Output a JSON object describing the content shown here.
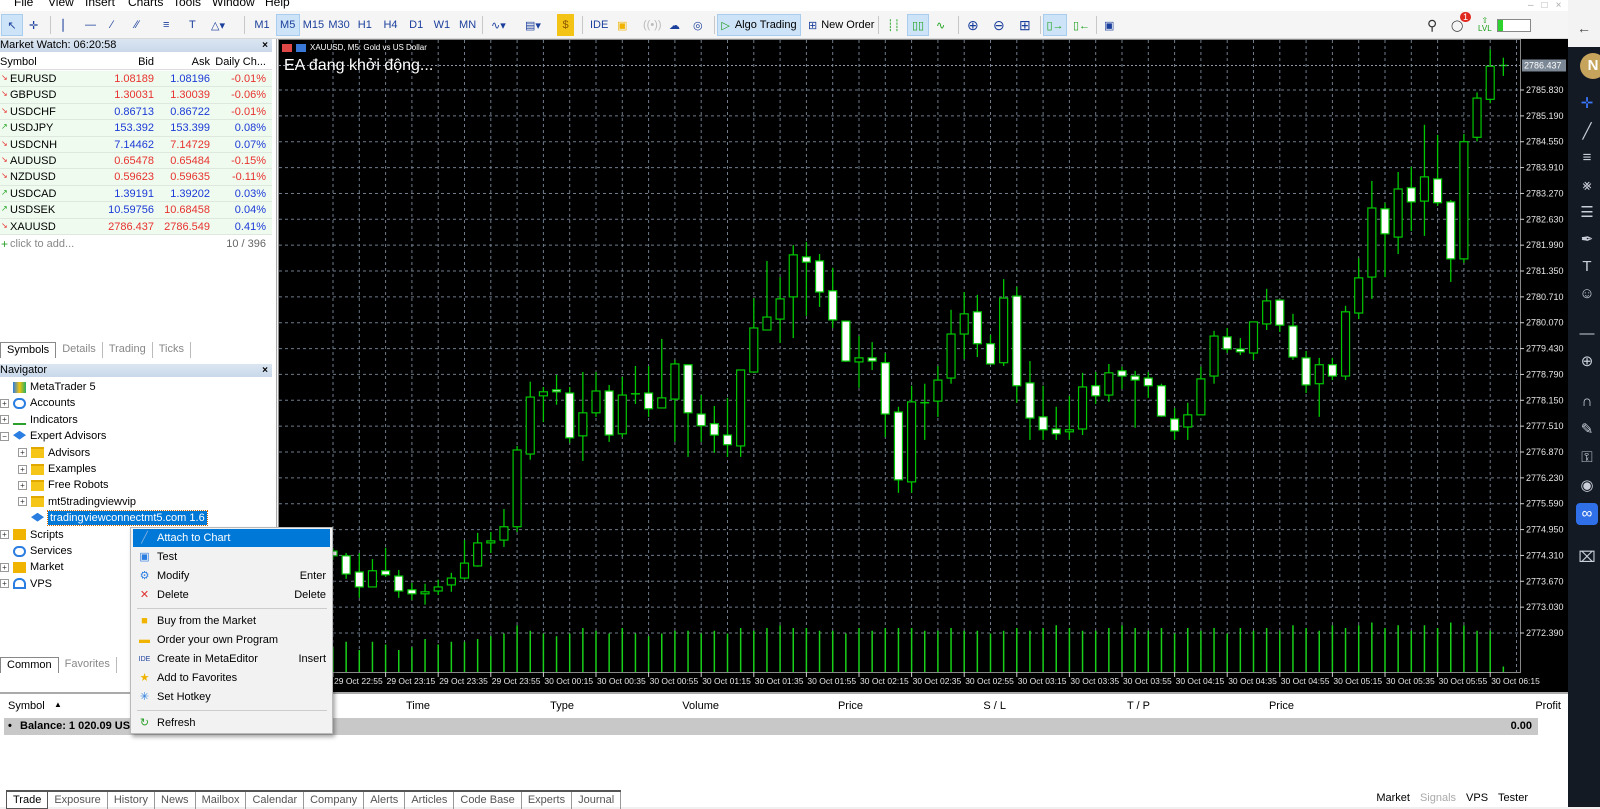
{
  "menu": [
    "File",
    "View",
    "Insert",
    "Charts",
    "Tools",
    "Window",
    "Help"
  ],
  "toolbar": {
    "timeframes": [
      "M1",
      "M5",
      "M15",
      "M30",
      "H1",
      "H4",
      "D1",
      "W1",
      "MN"
    ],
    "active_timeframe": "M5",
    "ide_label": "IDE",
    "algo_trading_label": "Algo Trading",
    "new_order_label": "New Order",
    "notification_count": "1",
    "lvl_label": "LVL",
    "user_initial": "N"
  },
  "market_watch": {
    "title": "Market Watch: 06:20:58",
    "columns": [
      "Symbol",
      "Bid",
      "Ask",
      "Daily Ch..."
    ],
    "rows": [
      {
        "symbol": "EURUSD",
        "bid": "1.08189",
        "ask": "1.08196",
        "change": "-0.01%",
        "dir": "down",
        "bid_c": "r",
        "ask_c": "b",
        "chg_c": "r"
      },
      {
        "symbol": "GBPUSD",
        "bid": "1.30031",
        "ask": "1.30039",
        "change": "-0.06%",
        "dir": "down",
        "bid_c": "r",
        "ask_c": "r",
        "chg_c": "r"
      },
      {
        "symbol": "USDCHF",
        "bid": "0.86713",
        "ask": "0.86722",
        "change": "-0.01%",
        "dir": "down",
        "bid_c": "b",
        "ask_c": "b",
        "chg_c": "r"
      },
      {
        "symbol": "USDJPY",
        "bid": "153.392",
        "ask": "153.399",
        "change": "0.08%",
        "dir": "up",
        "bid_c": "b",
        "ask_c": "b",
        "chg_c": "b"
      },
      {
        "symbol": "USDCNH",
        "bid": "7.14462",
        "ask": "7.14729",
        "change": "0.07%",
        "dir": "down",
        "bid_c": "b",
        "ask_c": "r",
        "chg_c": "b"
      },
      {
        "symbol": "AUDUSD",
        "bid": "0.65478",
        "ask": "0.65484",
        "change": "-0.15%",
        "dir": "down",
        "bid_c": "r",
        "ask_c": "r",
        "chg_c": "r"
      },
      {
        "symbol": "NZDUSD",
        "bid": "0.59623",
        "ask": "0.59635",
        "change": "-0.11%",
        "dir": "down",
        "bid_c": "r",
        "ask_c": "r",
        "chg_c": "r"
      },
      {
        "symbol": "USDCAD",
        "bid": "1.39191",
        "ask": "1.39202",
        "change": "0.03%",
        "dir": "up",
        "bid_c": "b",
        "ask_c": "b",
        "chg_c": "b"
      },
      {
        "symbol": "USDSEK",
        "bid": "10.59756",
        "ask": "10.68458",
        "change": "0.04%",
        "dir": "up",
        "bid_c": "b",
        "ask_c": "r",
        "chg_c": "b"
      },
      {
        "symbol": "XAUUSD",
        "bid": "2786.437",
        "ask": "2786.549",
        "change": "0.41%",
        "dir": "down",
        "bid_c": "r",
        "ask_c": "r",
        "chg_c": "b"
      }
    ],
    "add_label": "click to add...",
    "count": "10 / 396",
    "tabs": [
      "Symbols",
      "Details",
      "Trading",
      "Ticks"
    ]
  },
  "navigator": {
    "title": "Navigator",
    "items": [
      {
        "label": "MetaTrader 5",
        "level": 0,
        "icon": "metatrader-icon",
        "exp": ""
      },
      {
        "label": "Accounts",
        "level": 1,
        "icon": "accounts-icon",
        "exp": "+"
      },
      {
        "label": "Indicators",
        "level": 1,
        "icon": "indicators-icon",
        "exp": "+"
      },
      {
        "label": "Expert Advisors",
        "level": 1,
        "icon": "expert-advisors-icon",
        "exp": "-"
      },
      {
        "label": "Advisors",
        "level": 2,
        "icon": "folder-icon",
        "exp": "+"
      },
      {
        "label": "Examples",
        "level": 2,
        "icon": "folder-icon",
        "exp": "+"
      },
      {
        "label": "Free Robots",
        "level": 2,
        "icon": "folder-icon",
        "exp": "+"
      },
      {
        "label": "mt5tradingviewvip",
        "level": 2,
        "icon": "folder-icon",
        "exp": "+"
      },
      {
        "label": "tradingviewconnectmt5.com 1.6",
        "level": 2,
        "icon": "expert-icon",
        "exp": "",
        "selected": true
      },
      {
        "label": "Scripts",
        "level": 1,
        "icon": "scripts-icon",
        "exp": "+"
      },
      {
        "label": "Services",
        "level": 1,
        "icon": "services-icon",
        "exp": ""
      },
      {
        "label": "Market",
        "level": 1,
        "icon": "market-icon",
        "exp": "+"
      },
      {
        "label": "VPS",
        "level": 1,
        "icon": "vps-icon",
        "exp": "+"
      }
    ],
    "tabs": [
      "Common",
      "Favorites"
    ]
  },
  "context_menu": {
    "items": [
      {
        "label": "Attach to Chart",
        "shortcut": "",
        "icon": "attach-chart-icon",
        "highlighted": true
      },
      {
        "label": "Test",
        "shortcut": "",
        "icon": "test-icon"
      },
      {
        "label": "Modify",
        "shortcut": "Enter",
        "icon": "gear-icon"
      },
      {
        "label": "Delete",
        "shortcut": "Delete",
        "icon": "delete-icon"
      },
      {
        "label": "Buy from the Market",
        "shortcut": "",
        "icon": "market-bag-icon"
      },
      {
        "label": "Order your own Program",
        "shortcut": "",
        "icon": "briefcase-icon"
      },
      {
        "label": "Create in MetaEditor",
        "shortcut": "Insert",
        "icon": "ide-icon"
      },
      {
        "label": "Add to Favorites",
        "shortcut": "",
        "icon": "star-icon"
      },
      {
        "label": "Set Hotkey",
        "shortcut": "",
        "icon": "hotkey-icon"
      },
      {
        "label": "Refresh",
        "shortcut": "",
        "icon": "refresh-icon"
      }
    ]
  },
  "chart": {
    "header": "XAUUSD, M5:  Gold vs US Dollar",
    "overlay_text": "EA đang khởi động...",
    "colors": {
      "background": "#000000",
      "candle_outline": "#00c800",
      "bull_fill": "#000000",
      "bear_fill": "#ffffff",
      "grid": "#6f7c8c",
      "current_price_bg": "#7b8794"
    },
    "current_price": "2786.437",
    "price_labels": [
      "2785.830",
      "2785.190",
      "2784.550",
      "2783.910",
      "2783.270",
      "2782.630",
      "2781.990",
      "2781.350",
      "2780.710",
      "2780.070",
      "2779.430",
      "2778.790",
      "2778.150",
      "2777.510",
      "2776.870",
      "2776.230",
      "2775.590",
      "2774.950",
      "2774.310",
      "2773.670",
      "2773.030",
      "2772.390"
    ],
    "time_labels": [
      "29 Oct 22:55",
      "29 Oct 23:15",
      "29 Oct 23:35",
      "29 Oct 23:55",
      "30 Oct 00:15",
      "30 Oct 00:35",
      "30 Oct 00:55",
      "30 Oct 01:15",
      "30 Oct 01:35",
      "30 Oct 01:55",
      "30 Oct 02:15",
      "30 Oct 02:35",
      "30 Oct 02:55",
      "30 Oct 03:15",
      "30 Oct 03:35",
      "30 Oct 03:55",
      "30 Oct 04:15",
      "30 Oct 04:35",
      "30 Oct 04:55",
      "30 Oct 05:15",
      "30 Oct 05:35",
      "30 Oct 05:55",
      "30 Oct 06:15"
    ]
  },
  "chart_data": {
    "type": "candlestick",
    "symbol": "XAUUSD",
    "timeframe": "M5",
    "ylim": [
      2772.0,
      2787.2
    ],
    "grid": true,
    "ohlc": [
      [
        2774.42,
        2774.5,
        2774.2,
        2774.3
      ],
      [
        2774.3,
        2774.37,
        2773.73,
        2773.85
      ],
      [
        2773.9,
        2774.37,
        2773.26,
        2773.53
      ],
      [
        2773.53,
        2774.22,
        2773.53,
        2773.93
      ],
      [
        2773.93,
        2774.5,
        2773.78,
        2773.83
      ],
      [
        2773.8,
        2773.95,
        2773.26,
        2773.43
      ],
      [
        2773.46,
        2773.63,
        2773.21,
        2773.36
      ],
      [
        2773.36,
        2773.61,
        2773.09,
        2773.41
      ],
      [
        2773.43,
        2773.71,
        2773.33,
        2773.53
      ],
      [
        2773.58,
        2773.88,
        2773.41,
        2773.75
      ],
      [
        2773.75,
        2774.69,
        2773.71,
        2774.12
      ],
      [
        2774.05,
        2774.87,
        2774.03,
        2774.62
      ],
      [
        2774.62,
        2774.89,
        2774.37,
        2774.67
      ],
      [
        2774.69,
        2775.46,
        2774.52,
        2775.02
      ],
      [
        2775.02,
        2777.02,
        2774.89,
        2776.92
      ],
      [
        2776.82,
        2778.61,
        2776.68,
        2778.23
      ],
      [
        2778.26,
        2778.48,
        2777.61,
        2778.36
      ],
      [
        2778.41,
        2778.78,
        2778.04,
        2778.36
      ],
      [
        2778.33,
        2778.48,
        2777.1,
        2777.22
      ],
      [
        2777.27,
        2778.85,
        2776.65,
        2777.84
      ],
      [
        2777.84,
        2778.85,
        2777.74,
        2778.38
      ],
      [
        2778.38,
        2778.53,
        2777.12,
        2777.29
      ],
      [
        2777.32,
        2778.73,
        2777.24,
        2778.28
      ],
      [
        2778.31,
        2779.0,
        2778.06,
        2778.3
      ],
      [
        2778.33,
        2779.0,
        2777.74,
        2777.94
      ],
      [
        2777.96,
        2779.67,
        2777.96,
        2778.21
      ],
      [
        2778.18,
        2779.15,
        2777.12,
        2779.05
      ],
      [
        2779.03,
        2779.03,
        2776.75,
        2777.84
      ],
      [
        2777.81,
        2778.28,
        2777.12,
        2777.52
      ],
      [
        2777.57,
        2778.01,
        2776.85,
        2777.29
      ],
      [
        2777.29,
        2778.21,
        2776.75,
        2777.05
      ],
      [
        2777.02,
        2778.9,
        2776.75,
        2778.9
      ],
      [
        2778.85,
        2780.68,
        2778.83,
        2779.94
      ],
      [
        2779.89,
        2781.6,
        2779.89,
        2780.21
      ],
      [
        2780.16,
        2781.2,
        2779.57,
        2780.66
      ],
      [
        2780.71,
        2781.99,
        2779.69,
        2781.75
      ],
      [
        2781.7,
        2782.07,
        2780.24,
        2781.57
      ],
      [
        2781.6,
        2781.77,
        2780.46,
        2780.83
      ],
      [
        2780.86,
        2781.43,
        2779.94,
        2780.14
      ],
      [
        2780.11,
        2780.11,
        2779.1,
        2779.12
      ],
      [
        2779.1,
        2779.74,
        2778.46,
        2779.2
      ],
      [
        2779.2,
        2779.59,
        2778.9,
        2779.12
      ],
      [
        2779.08,
        2779.32,
        2777.24,
        2777.81
      ],
      [
        2777.86,
        2777.99,
        2775.86,
        2776.18
      ],
      [
        2776.13,
        2778.51,
        2775.86,
        2778.11
      ],
      [
        2778.08,
        2778.56,
        2777.17,
        2778.09
      ],
      [
        2778.13,
        2779.0,
        2777.74,
        2778.65
      ],
      [
        2778.7,
        2780.39,
        2778.56,
        2779.79
      ],
      [
        2779.79,
        2780.83,
        2779.17,
        2780.29
      ],
      [
        2780.34,
        2780.76,
        2779.22,
        2779.55
      ],
      [
        2779.55,
        2779.77,
        2779.05,
        2779.05
      ],
      [
        2779.08,
        2781.15,
        2779.0,
        2780.68
      ],
      [
        2780.73,
        2780.96,
        2778.09,
        2778.51
      ],
      [
        2778.58,
        2779.12,
        2777.17,
        2777.71
      ],
      [
        2777.74,
        2778.51,
        2777.17,
        2777.42
      ],
      [
        2777.44,
        2777.99,
        2777.17,
        2777.32
      ],
      [
        2777.37,
        2778.26,
        2777.17,
        2777.42
      ],
      [
        2777.44,
        2778.83,
        2777.29,
        2778.48
      ],
      [
        2778.51,
        2778.85,
        2778.06,
        2778.26
      ],
      [
        2778.28,
        2779.05,
        2778.11,
        2778.83
      ],
      [
        2778.88,
        2778.98,
        2778.43,
        2778.75
      ],
      [
        2778.75,
        2778.88,
        2777.47,
        2778.65
      ],
      [
        2778.7,
        2778.85,
        2778.21,
        2778.51
      ],
      [
        2778.51,
        2778.56,
        2777.74,
        2777.76
      ],
      [
        2777.69,
        2777.96,
        2777.17,
        2777.39
      ],
      [
        2777.49,
        2778.09,
        2777.17,
        2777.79
      ],
      [
        2777.79,
        2778.98,
        2777.79,
        2778.68
      ],
      [
        2778.75,
        2779.87,
        2778.56,
        2779.74
      ],
      [
        2779.72,
        2779.94,
        2779.32,
        2779.42
      ],
      [
        2779.42,
        2779.69,
        2779.27,
        2779.35
      ],
      [
        2779.32,
        2780.09,
        2779.15,
        2780.09
      ],
      [
        2780.04,
        2780.91,
        2779.89,
        2780.61
      ],
      [
        2780.63,
        2780.63,
        2779.84,
        2780.01
      ],
      [
        2779.99,
        2780.29,
        2779.15,
        2779.22
      ],
      [
        2779.2,
        2779.37,
        2778.33,
        2778.53
      ],
      [
        2778.56,
        2779.2,
        2777.74,
        2779.03
      ],
      [
        2779.03,
        2779.2,
        2778.65,
        2778.75
      ],
      [
        2778.75,
        2780.49,
        2778.65,
        2780.34
      ],
      [
        2780.31,
        2781.67,
        2780.16,
        2781.18
      ],
      [
        2781.2,
        2783.58,
        2780.66,
        2782.91
      ],
      [
        2782.89,
        2783.04,
        2781.2,
        2782.27
      ],
      [
        2782.19,
        2783.8,
        2781.77,
        2783.38
      ],
      [
        2783.41,
        2783.93,
        2782.34,
        2783.06
      ],
      [
        2783.08,
        2784.97,
        2782.22,
        2783.68
      ],
      [
        2783.63,
        2784.72,
        2782.96,
        2783.04
      ],
      [
        2783.06,
        2783.11,
        2781.08,
        2781.65
      ],
      [
        2781.65,
        2784.74,
        2781.55,
        2784.55
      ],
      [
        2784.66,
        2785.77,
        2784.56,
        2785.63
      ],
      [
        2785.6,
        2786.84,
        2785.5,
        2786.42
      ],
      [
        2786.4,
        2786.63,
        2786.18,
        2786.437
      ]
    ],
    "volume_relative": [
      45,
      55,
      40,
      55,
      50,
      40,
      45,
      60,
      50,
      55,
      55,
      60,
      65,
      70,
      85,
      75,
      70,
      65,
      70,
      80,
      75,
      70,
      80,
      70,
      65,
      70,
      75,
      75,
      70,
      75,
      70,
      80,
      75,
      80,
      85,
      80,
      80,
      75,
      75,
      70,
      80,
      75,
      80,
      80,
      80,
      75,
      75,
      80,
      75,
      75,
      70,
      75,
      80,
      75,
      80,
      85,
      80,
      75,
      75,
      80,
      85,
      80,
      75,
      80,
      70,
      80,
      75,
      80,
      70,
      80,
      75,
      80,
      75,
      85,
      80,
      75,
      85,
      80,
      85,
      90,
      80,
      85,
      75,
      85,
      80,
      90,
      85,
      75,
      75,
      10
    ]
  },
  "toolbox": {
    "columns": [
      "Symbol",
      "Time",
      "Type",
      "Volume",
      "Price",
      "S / L",
      "T / P",
      "Price",
      "Profit"
    ],
    "balance_label": "Balance: 1 020.09 USD",
    "profit": "0.00",
    "tabs": [
      "Trade",
      "Exposure",
      "History",
      "News",
      "Mailbox",
      "Calendar",
      "Company",
      "Alerts",
      "Articles",
      "Code Base",
      "Experts",
      "Journal"
    ],
    "right_tabs": [
      "Market",
      "Signals",
      "VPS",
      "Tester"
    ]
  }
}
